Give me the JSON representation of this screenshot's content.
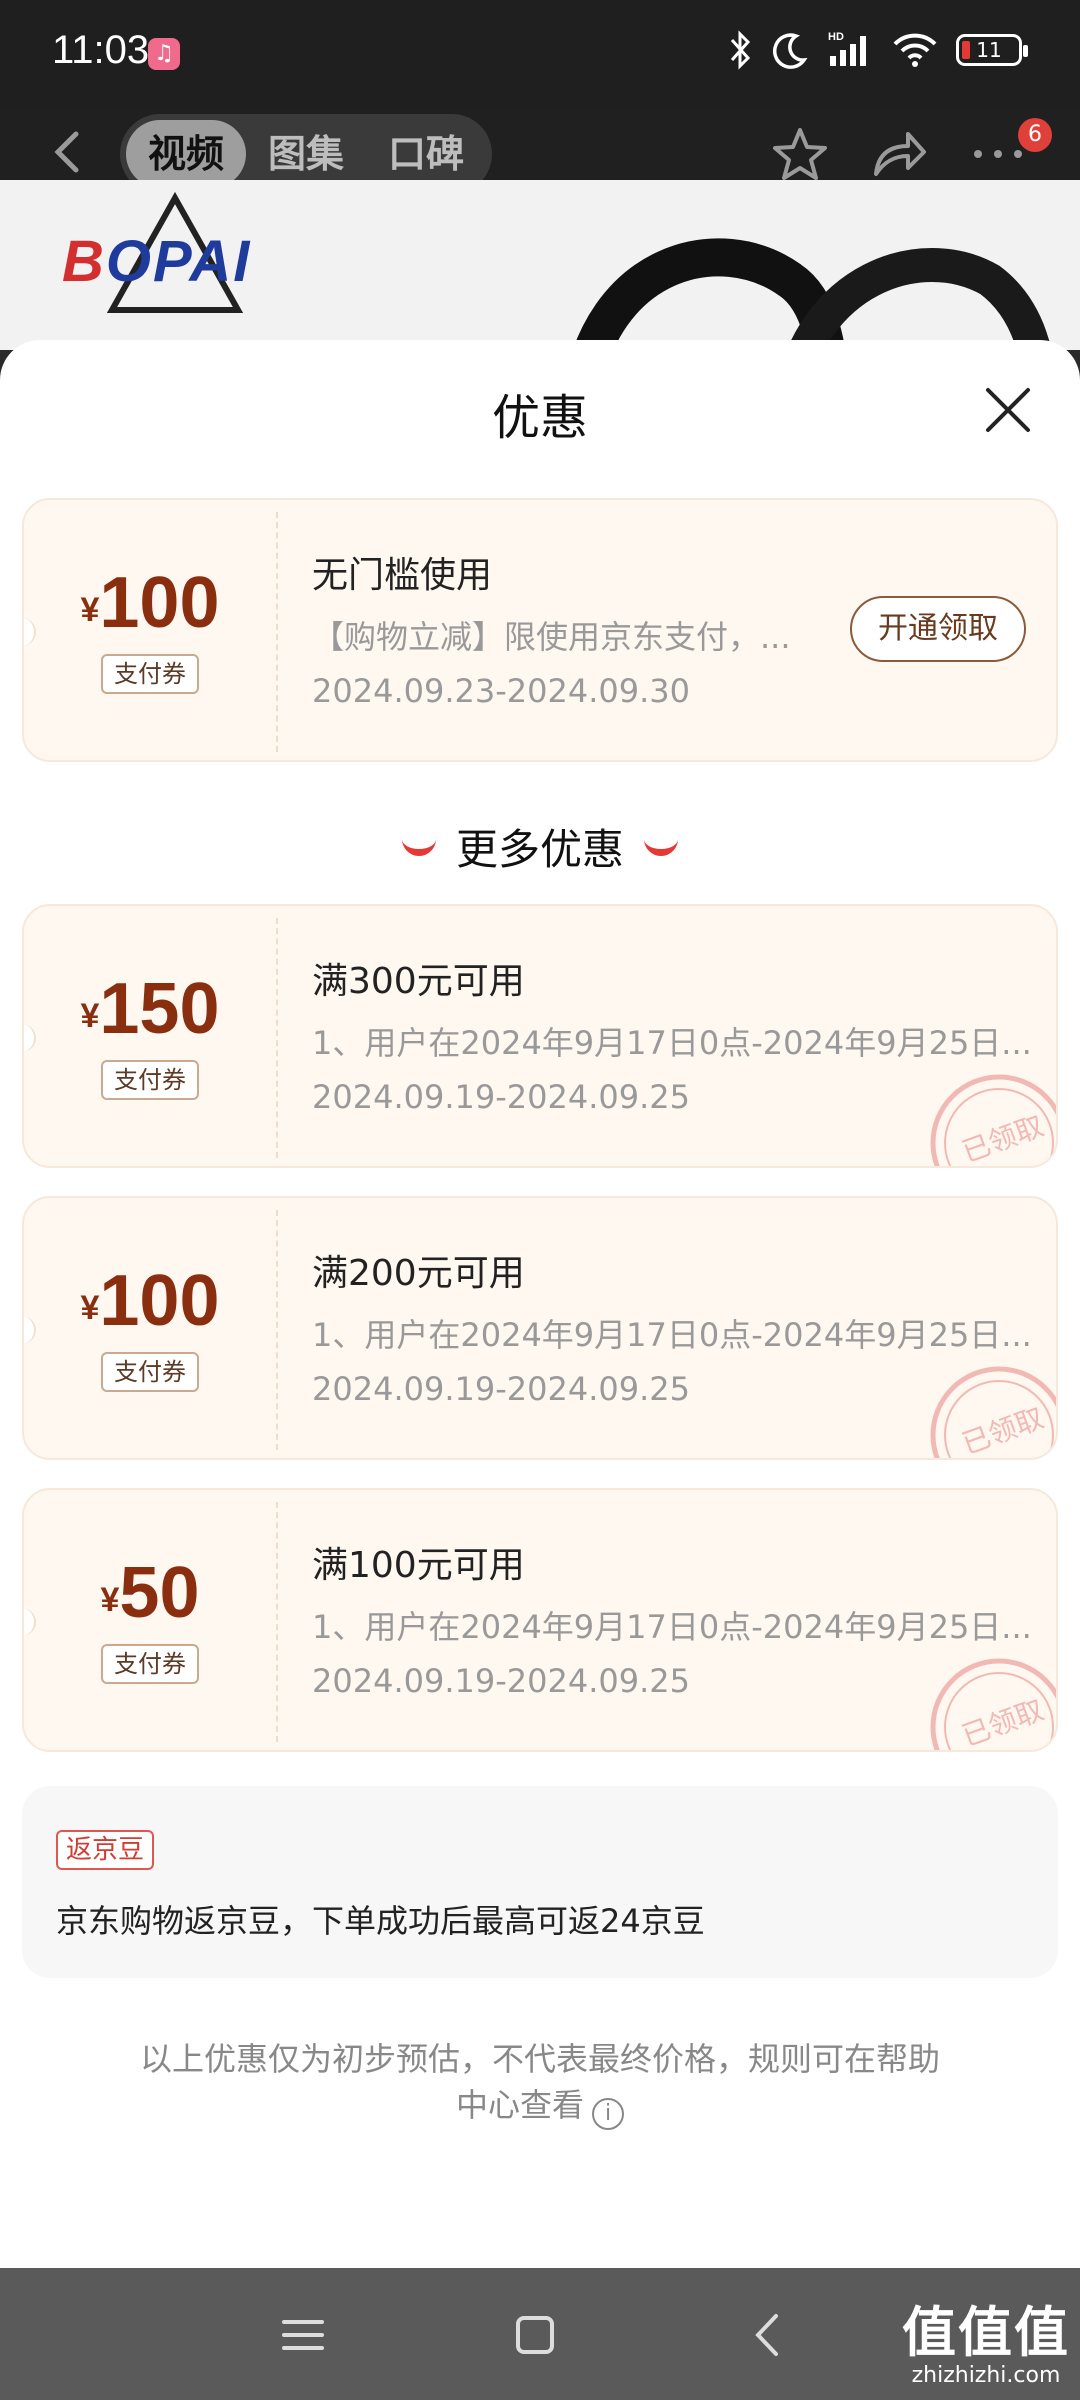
{
  "status_bar": {
    "time": "11:03",
    "battery": "11",
    "icons": [
      "music-app-icon",
      "bluetooth-icon",
      "moon-icon",
      "hd-signal-icon",
      "wifi-icon",
      "battery-icon"
    ]
  },
  "header": {
    "tabs": [
      {
        "label": "视频",
        "active": true
      },
      {
        "label": "图集",
        "active": false
      },
      {
        "label": "口碑",
        "active": false
      }
    ],
    "badge_count": "6",
    "brand_logo": "BOPAI"
  },
  "sheet": {
    "title": "优惠",
    "main_coupon": {
      "currency": "¥",
      "amount": "100",
      "tag": "支付券",
      "title": "无门槛使用",
      "desc": "【购物立减】限使用京东支付，...",
      "date": "2024.09.23-2024.09.30",
      "button": "开通领取"
    },
    "more_title": "更多优惠",
    "coupons": [
      {
        "currency": "¥",
        "amount": "150",
        "tag": "支付券",
        "title": "满300元可用",
        "desc": "1、用户在2024年9月17日0点-2024年9月25日...",
        "date": "2024.09.19-2024.09.25",
        "stamp": "已领取"
      },
      {
        "currency": "¥",
        "amount": "100",
        "tag": "支付券",
        "title": "满200元可用",
        "desc": "1、用户在2024年9月17日0点-2024年9月25日...",
        "date": "2024.09.19-2024.09.25",
        "stamp": "已领取"
      },
      {
        "currency": "¥",
        "amount": "50",
        "tag": "支付券",
        "title": "满100元可用",
        "desc": "1、用户在2024年9月17日0点-2024年9月25日...",
        "date": "2024.09.19-2024.09.25",
        "stamp": "已领取"
      }
    ],
    "rebate": {
      "tag": "返京豆",
      "text": "京东购物返京豆，下单成功后最高可返24京豆"
    },
    "footnote": "以上优惠仅为初步预估，不代表最终价格，规则可在帮助中心查看"
  },
  "watermark": {
    "big": "值值值",
    "small": "zhizhizhi.com"
  },
  "colors": {
    "accent_red": "#e53935",
    "coupon_bg": "#fff8f1",
    "amount_brown": "#8a2e10"
  }
}
